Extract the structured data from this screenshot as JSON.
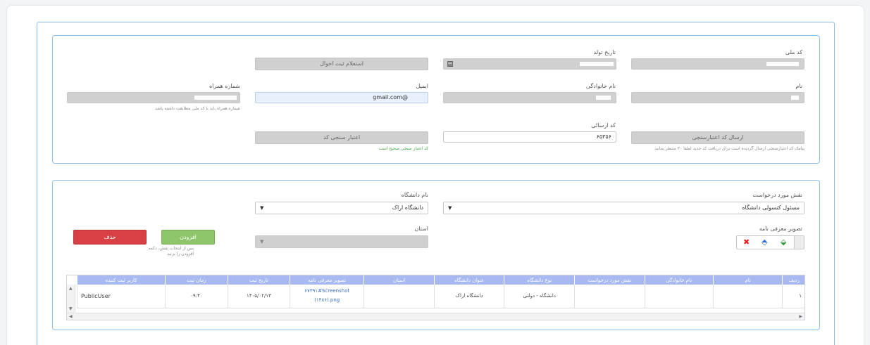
{
  "personal_info": {
    "national_code": {
      "label": "کد ملی",
      "value": ""
    },
    "birth_date": {
      "label": "تاریخ تولد",
      "value": ""
    },
    "civil_registry_button": "استعلام ثبت احوال",
    "first_name": {
      "label": "نام",
      "value": ""
    },
    "last_name": {
      "label": "نام خانوادگی",
      "value": ""
    },
    "email": {
      "label": "ایمیل",
      "value": "@gmail.com"
    },
    "mobile": {
      "label": "شماره همراه",
      "value": "",
      "hint": "شماره همراه باید با کد ملی مطابقت داشته باشد"
    },
    "send_code_button": "ارسال کد اعتبارسنجی",
    "send_code_hint": "پیامک کد اعتبارسنجی ارسال گردیده است برای دریافت کد جدید لطفا ۳۰ منتظر بمانید",
    "sent_code": {
      "label": "کد ارسالی",
      "value": "۶۵۳۵۶"
    },
    "verify_button": "اعتبار سنجی کد",
    "verify_success": "کد اعتبار سنجی صحیح است"
  },
  "request": {
    "role": {
      "label": "نقش مورد درخواست",
      "value": "مسئول کنسولی دانشگاه"
    },
    "university": {
      "label": "نام دانشگاه",
      "value": "دانشگاه اراک"
    },
    "province": {
      "label": "استان",
      "value": ""
    },
    "intro_letter_label": "تصویر معرفی نامه",
    "add_button": "افزودن",
    "add_hint": "پس از انتخاب نقش، دکمه افزودن را بزنید",
    "delete_button": "حذف"
  },
  "grid": {
    "columns": [
      "ردیف",
      "نام",
      "نام خانوادگی",
      "نقش مورد درخواست",
      "نوع دانشگاه",
      "عنوان دانشگاه",
      "استان",
      "تصویر معرفی نامه",
      "تاریخ ثبت",
      "زمان ثبت",
      "کاربر ثبت کننده"
    ],
    "rows": [
      {
        "row_no": "۱",
        "first_name": "",
        "last_name": "",
        "role": "",
        "uni_type": "دانشگاه - دولتی",
        "uni_title": "دانشگاه اراک",
        "province": "",
        "letter": "۶۷۳۹۱#Screenshot (۱۴۸۶).png",
        "date": "۱۴۰۵/۰۲/۱۳",
        "time": "۰۹:۴۰",
        "user": "PublicUser"
      }
    ]
  },
  "colors": {
    "panel_border": "#8fc0ec",
    "add_button": "#8ec56a",
    "delete_button": "#d74145",
    "grid_header": "#a7b9f0",
    "link": "#3b6fc1"
  }
}
